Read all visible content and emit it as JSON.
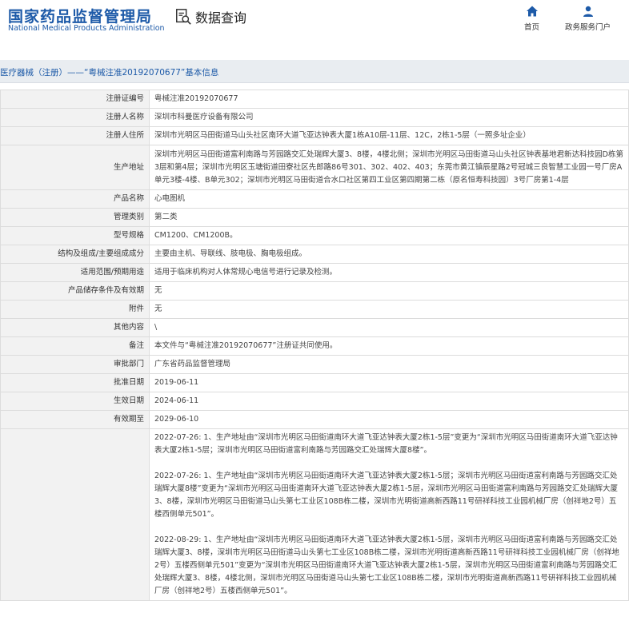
{
  "header": {
    "org_name_cn": "国家药品监督管理局",
    "org_name_en": "National Medical Products Administration",
    "system_title": "数据查询",
    "nav_home": "首页",
    "nav_portal": "政务服务门户"
  },
  "breadcrumb": "医疗器械（注册）——“粤械注准20192070677”基本信息",
  "rows": [
    {
      "label": "注册证编号",
      "value": "粤械注准20192070677"
    },
    {
      "label": "注册人名称",
      "value": "深圳市科曼医疗设备有限公司"
    },
    {
      "label": "注册人住所",
      "value": "深圳市光明区马田街道马山头社区南环大道飞亚达钟表大厦1栋A10层-11层、12C，2栋1-5层（一照多址企业）"
    },
    {
      "label": "生产地址",
      "value": "深圳市光明区马田街道富利南路与芳园路交汇处瑞辉大厦3、8楼，4楼北侧；深圳市光明区马田街道马山头社区钟表基地君新达科技园D栋第3层和第4层；深圳市光明区玉塘街道田寮社区先郎路86号301、302、402、403；东莞市黄江镇辰星路2号冠城三良智慧工业园一号厂房A单元3楼-4楼、B单元302；深圳市光明区马田街道合水口社区第四工业区第四期第二栋（原名恒寿科技园）3号厂房第1-4层"
    },
    {
      "label": "产品名称",
      "value": "心电图机"
    },
    {
      "label": "管理类别",
      "value": "第二类"
    },
    {
      "label": "型号规格",
      "value": "CM1200、CM1200B。"
    },
    {
      "label": "结构及组成/主要组成成分",
      "value": "主要由主机、导联线、肢电极、胸电极组成。"
    },
    {
      "label": "适用范围/预期用途",
      "value": "适用于临床机构对人体常规心电信号进行记录及检测。"
    },
    {
      "label": "产品储存条件及有效期",
      "value": "无"
    },
    {
      "label": "附件",
      "value": "无"
    },
    {
      "label": "其他内容",
      "value": "\\"
    },
    {
      "label": "备注",
      "value": "本文件与“粤械注准20192070677”注册证共同使用。"
    },
    {
      "label": "审批部门",
      "value": "广东省药品监督管理局"
    },
    {
      "label": "批准日期",
      "value": "2019-06-11"
    },
    {
      "label": "生效日期",
      "value": "2024-06-11"
    },
    {
      "label": "有效期至",
      "value": "2029-06-10"
    }
  ],
  "changes": [
    "2022-07-26: 1、生产地址由“深圳市光明区马田街道南环大道飞亚达钟表大厦2栋1-5层”变更为“深圳市光明区马田街道南环大道飞亚达钟表大厦2栋1-5层；深圳市光明区马田街道富利南路与芳园路交汇处瑞辉大厦8楼”。",
    "2022-07-26: 1、生产地址由“深圳市光明区马田街道南环大道飞亚达钟表大厦2栋1-5层；深圳市光明区马田街道富利南路与芳园路交汇处瑞辉大厦8楼”变更为“深圳市光明区马田街道南环大道飞亚达钟表大厦2栋1-5层，深圳市光明区马田街道富利南路与芳园路交汇处瑞辉大厦3、8楼，深圳市光明区马田街道马山头第七工业区108B栋二楼，深圳市光明街道高新西路11号研祥科技工业园机械厂房（创祥地2号）五楼西侧单元501”。",
    "2022-08-29: 1、生产地址由“深圳市光明区马田街道南环大道飞亚达钟表大厦2栋1-5层，深圳市光明区马田街道富利南路与芳园路交汇处瑞辉大厦3、8楼，深圳市光明区马田街道马山头第七工业区108B栋二楼，深圳市光明街道高新西路11号研祥科技工业园机械厂房（创祥地2号）五楼西侧单元501”变更为“深圳市光明区马田街道南环大道飞亚达钟表大厦2栋1-5层，深圳市光明区马田街道富利南路与芳园路交汇处瑞辉大厦3、8楼，4楼北侧，深圳市光明区马田街道马山头第七工业区108B栋二楼，深圳市光明街道高新西路11号研祥科技工业园机械厂房（创祥地2号）五楼西侧单元501”。"
  ]
}
